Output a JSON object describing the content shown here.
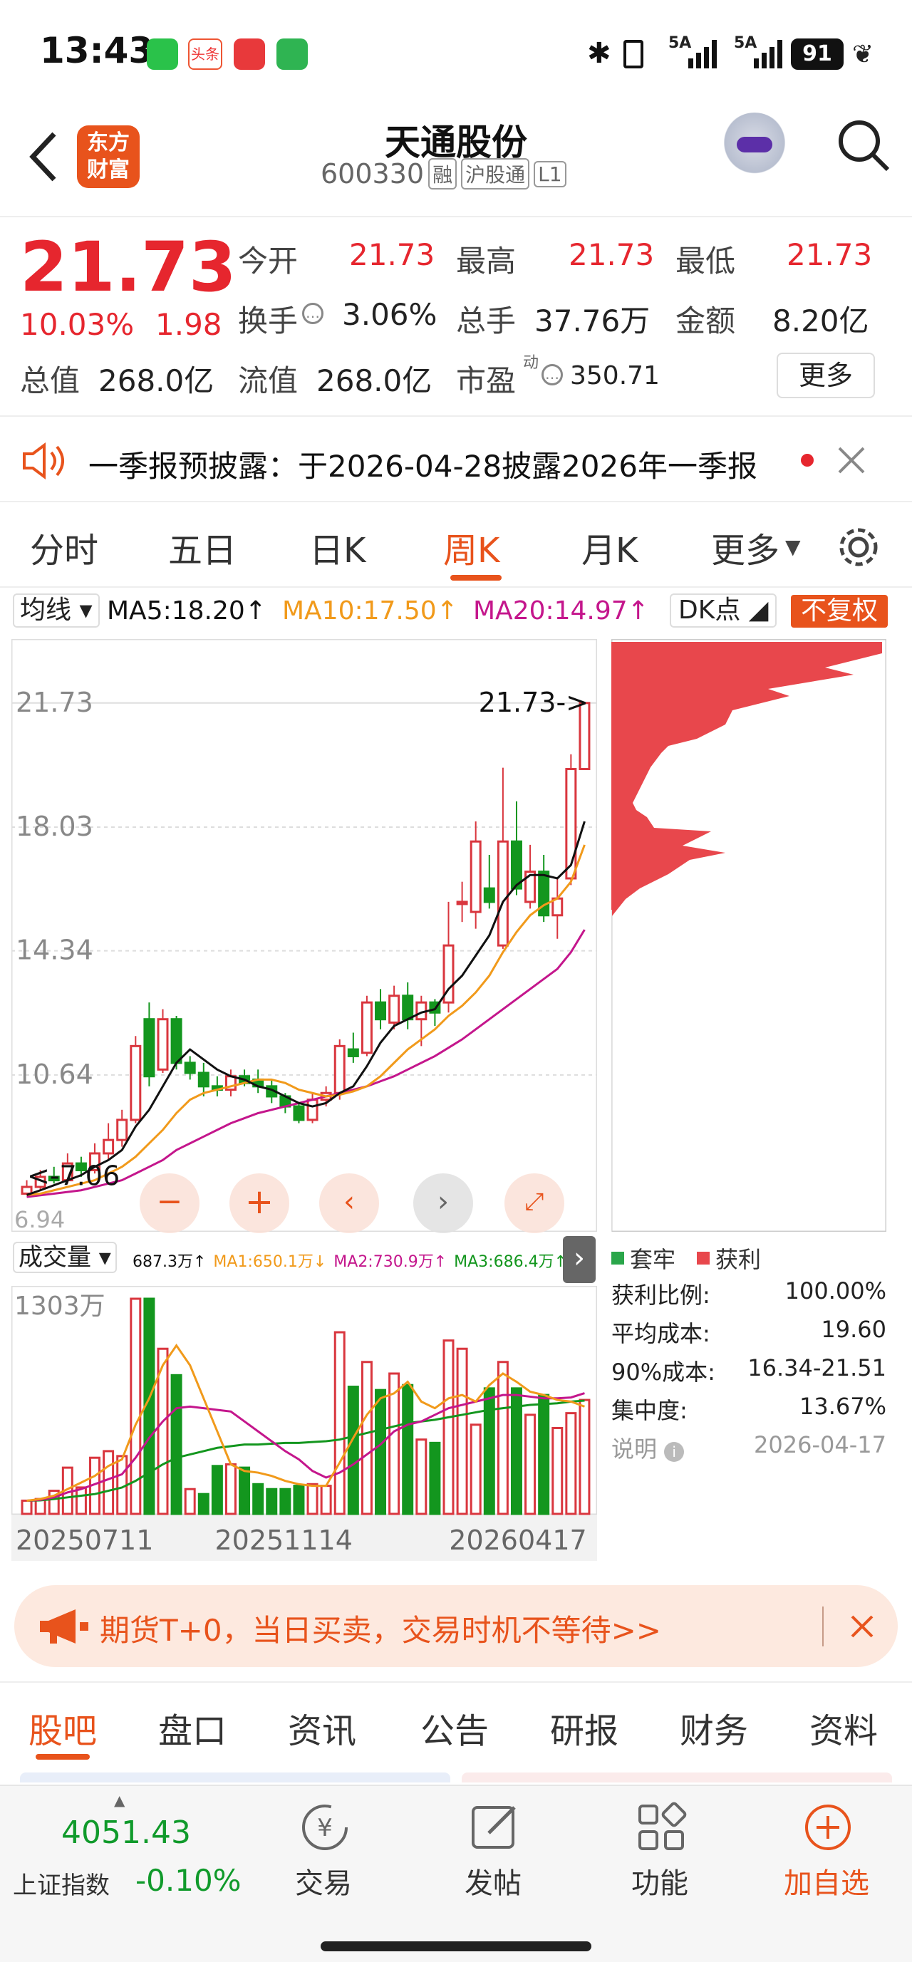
{
  "status_bar": {
    "time": "13:43",
    "battery": "91",
    "network1": "5A",
    "network2": "5A"
  },
  "header": {
    "title": "天通股份",
    "code": "600330",
    "badges": [
      "融",
      "沪股通",
      "L1"
    ],
    "logo_text": [
      "东方",
      "财富"
    ]
  },
  "quote": {
    "price": "21.73",
    "change_pct": "10.03%",
    "change_amt": "1.98",
    "open_label": "今开",
    "open": "21.73",
    "high_label": "最高",
    "high": "21.73",
    "low_label": "最低",
    "low": "21.73",
    "turnover_label": "换手",
    "turnover": "3.06%",
    "volume_label": "总手",
    "volume": "37.76万",
    "amount_label": "金额",
    "amount": "8.20亿",
    "total_value_label": "总值",
    "total_value": "268.0亿",
    "float_value_label": "流值",
    "float_value": "268.0亿",
    "pe_label": "市盈",
    "pe_sup": "动",
    "pe": "350.71",
    "more_button": "更多"
  },
  "notice": {
    "text": "一季报预披露：于2026-04-28披露2026年一季报"
  },
  "tabs": {
    "items": [
      "分时",
      "五日",
      "日K",
      "周K",
      "月K",
      "更多"
    ],
    "active": "周K"
  },
  "indicators": {
    "ma_selector": "均线",
    "ma5": "MA5:18.20↑",
    "ma10": "MA10:17.50↑",
    "ma20": "MA20:14.97↑",
    "dk": "DK点",
    "fq": "不复权",
    "colors": {
      "ma5": "#111111",
      "ma10": "#f19a1b",
      "ma20": "#c4168c"
    }
  },
  "chart_data": {
    "type": "candlestick",
    "price_ticks": [
      "21.73",
      "18.03",
      "14.34",
      "10.64"
    ],
    "high_marker": "21.73->",
    "low_marker": "<-7.06",
    "low_partial": "6.94",
    "volume_title": "成交量",
    "volume_info": [
      "687.3万↑",
      "MA1:650.1万↓",
      "MA2:730.9万↑",
      "MA3:686.4万↑"
    ],
    "volume_max": "1303万",
    "date_labels": [
      "20250711",
      "20251114",
      "20260417"
    ],
    "candles": [
      {
        "o": 7.1,
        "c": 7.3,
        "h": 7.5,
        "l": 7.06,
        "up": true
      },
      {
        "o": 7.3,
        "c": 7.6,
        "h": 7.8,
        "l": 7.2,
        "up": true
      },
      {
        "o": 7.6,
        "c": 7.5,
        "h": 7.9,
        "l": 7.4,
        "up": false
      },
      {
        "o": 7.5,
        "c": 8.0,
        "h": 8.3,
        "l": 7.4,
        "up": true
      },
      {
        "o": 8.0,
        "c": 7.8,
        "h": 8.2,
        "l": 7.6,
        "up": false
      },
      {
        "o": 7.8,
        "c": 8.3,
        "h": 8.6,
        "l": 7.7,
        "up": true
      },
      {
        "o": 8.3,
        "c": 8.7,
        "h": 9.2,
        "l": 8.1,
        "up": true
      },
      {
        "o": 8.7,
        "c": 9.3,
        "h": 9.6,
        "l": 8.5,
        "up": true
      },
      {
        "o": 9.3,
        "c": 11.5,
        "h": 11.8,
        "l": 9.2,
        "up": true
      },
      {
        "o": 12.3,
        "c": 10.6,
        "h": 12.8,
        "l": 10.3,
        "up": false
      },
      {
        "o": 10.8,
        "c": 12.3,
        "h": 12.6,
        "l": 10.7,
        "up": true
      },
      {
        "o": 12.3,
        "c": 11.0,
        "h": 12.4,
        "l": 10.8,
        "up": false
      },
      {
        "o": 11.0,
        "c": 10.7,
        "h": 11.2,
        "l": 10.5,
        "up": false
      },
      {
        "o": 10.7,
        "c": 10.3,
        "h": 11.0,
        "l": 10.0,
        "up": false
      },
      {
        "o": 10.3,
        "c": 10.2,
        "h": 10.6,
        "l": 10.0,
        "up": false
      },
      {
        "o": 10.2,
        "c": 10.6,
        "h": 10.8,
        "l": 10.0,
        "up": true
      },
      {
        "o": 10.6,
        "c": 10.4,
        "h": 10.8,
        "l": 10.3,
        "up": false
      },
      {
        "o": 10.5,
        "c": 10.3,
        "h": 10.8,
        "l": 10.1,
        "up": false
      },
      {
        "o": 10.3,
        "c": 10.0,
        "h": 10.5,
        "l": 9.8,
        "up": false
      },
      {
        "o": 10.0,
        "c": 9.7,
        "h": 10.1,
        "l": 9.5,
        "up": false
      },
      {
        "o": 9.7,
        "c": 9.3,
        "h": 9.8,
        "l": 9.2,
        "up": false
      },
      {
        "o": 9.3,
        "c": 9.9,
        "h": 10.1,
        "l": 9.2,
        "up": true
      },
      {
        "o": 9.9,
        "c": 10.1,
        "h": 10.3,
        "l": 9.7,
        "up": true
      },
      {
        "o": 10.1,
        "c": 11.5,
        "h": 11.7,
        "l": 9.9,
        "up": true
      },
      {
        "o": 11.4,
        "c": 11.2,
        "h": 11.9,
        "l": 11.0,
        "up": false
      },
      {
        "o": 11.3,
        "c": 12.8,
        "h": 13.0,
        "l": 11.2,
        "up": true
      },
      {
        "o": 12.8,
        "c": 12.3,
        "h": 13.2,
        "l": 12.0,
        "up": false
      },
      {
        "o": 12.2,
        "c": 13.0,
        "h": 13.3,
        "l": 12.0,
        "up": true
      },
      {
        "o": 13.0,
        "c": 12.3,
        "h": 13.4,
        "l": 12.0,
        "up": false
      },
      {
        "o": 12.3,
        "c": 12.8,
        "h": 13.0,
        "l": 11.5,
        "up": true
      },
      {
        "o": 12.8,
        "c": 12.5,
        "h": 12.9,
        "l": 12.1,
        "up": false
      },
      {
        "o": 12.8,
        "c": 14.5,
        "h": 15.8,
        "l": 12.5,
        "up": true
      },
      {
        "o": 15.8,
        "c": 15.8,
        "h": 16.4,
        "l": 15.2,
        "up": true
      },
      {
        "o": 15.5,
        "c": 17.6,
        "h": 18.2,
        "l": 15.0,
        "up": true
      },
      {
        "o": 16.2,
        "c": 15.8,
        "h": 17.2,
        "l": 15.6,
        "up": false
      },
      {
        "o": 14.5,
        "c": 17.6,
        "h": 19.8,
        "l": 14.4,
        "up": true
      },
      {
        "o": 17.6,
        "c": 16.2,
        "h": 18.8,
        "l": 16.0,
        "up": false
      },
      {
        "o": 15.8,
        "c": 16.7,
        "h": 17.5,
        "l": 15.6,
        "up": true
      },
      {
        "o": 16.7,
        "c": 15.4,
        "h": 17.2,
        "l": 15.2,
        "up": false
      },
      {
        "o": 15.4,
        "c": 15.9,
        "h": 16.5,
        "l": 14.7,
        "up": true
      },
      {
        "o": 16.5,
        "c": 19.76,
        "h": 20.2,
        "l": 16.3,
        "up": true
      },
      {
        "o": 19.76,
        "c": 21.73,
        "h": 21.73,
        "l": 19.76,
        "up": true
      }
    ],
    "volumes": [
      {
        "v": 80,
        "up": true
      },
      {
        "v": 90,
        "up": true
      },
      {
        "v": 140,
        "up": true
      },
      {
        "v": 280,
        "up": true
      },
      {
        "v": 160,
        "up": true
      },
      {
        "v": 340,
        "up": true
      },
      {
        "v": 380,
        "up": true
      },
      {
        "v": 350,
        "up": true
      },
      {
        "v": 1303,
        "up": true
      },
      {
        "v": 1303,
        "up": false
      },
      {
        "v": 1000,
        "up": true
      },
      {
        "v": 840,
        "up": false
      },
      {
        "v": 150,
        "up": true
      },
      {
        "v": 120,
        "up": false
      },
      {
        "v": 290,
        "up": false
      },
      {
        "v": 300,
        "up": true
      },
      {
        "v": 280,
        "up": false
      },
      {
        "v": 180,
        "up": false
      },
      {
        "v": 150,
        "up": false
      },
      {
        "v": 150,
        "up": false
      },
      {
        "v": 170,
        "up": false
      },
      {
        "v": 180,
        "up": true
      },
      {
        "v": 170,
        "up": true
      },
      {
        "v": 1100,
        "up": true
      },
      {
        "v": 770,
        "up": false
      },
      {
        "v": 920,
        "up": true
      },
      {
        "v": 750,
        "up": false
      },
      {
        "v": 850,
        "up": true
      },
      {
        "v": 780,
        "up": false
      },
      {
        "v": 450,
        "up": true
      },
      {
        "v": 430,
        "up": false
      },
      {
        "v": 1050,
        "up": true
      },
      {
        "v": 1000,
        "up": true
      },
      {
        "v": 540,
        "up": true
      },
      {
        "v": 760,
        "up": false
      },
      {
        "v": 920,
        "up": true
      },
      {
        "v": 760,
        "up": false
      },
      {
        "v": 600,
        "up": true
      },
      {
        "v": 720,
        "up": false
      },
      {
        "v": 520,
        "up": true
      },
      {
        "v": 610,
        "up": true
      },
      {
        "v": 690,
        "up": true
      }
    ],
    "ma5_line": [
      7.06,
      7.2,
      7.35,
      7.5,
      7.65,
      7.9,
      8.1,
      8.4,
      9.1,
      9.6,
      10.3,
      11.0,
      11.4,
      11.1,
      10.8,
      10.6,
      10.5,
      10.3,
      10.2,
      10.0,
      9.8,
      9.7,
      9.8,
      10.1,
      10.3,
      10.9,
      11.6,
      12.1,
      12.3,
      12.5,
      12.6,
      13.2,
      13.6,
      14.2,
      14.8,
      15.8,
      16.3,
      16.6,
      16.6,
      16.5,
      16.9,
      18.2
    ],
    "ma10_line": [
      7.06,
      7.1,
      7.2,
      7.3,
      7.4,
      7.5,
      7.7,
      7.9,
      8.2,
      8.6,
      9.0,
      9.5,
      9.9,
      10.1,
      10.2,
      10.3,
      10.4,
      10.5,
      10.5,
      10.4,
      10.2,
      10.1,
      10.0,
      10.05,
      10.15,
      10.3,
      10.6,
      11.0,
      11.4,
      11.7,
      12.0,
      12.4,
      12.7,
      13.1,
      13.6,
      14.3,
      14.9,
      15.4,
      15.7,
      15.9,
      16.4,
      17.5
    ],
    "ma20_line": [
      7.0,
      7.05,
      7.1,
      7.15,
      7.2,
      7.3,
      7.4,
      7.5,
      7.7,
      7.9,
      8.1,
      8.4,
      8.6,
      8.8,
      9.0,
      9.2,
      9.35,
      9.5,
      9.6,
      9.7,
      9.8,
      9.9,
      10.0,
      10.1,
      10.2,
      10.3,
      10.45,
      10.6,
      10.8,
      11.0,
      11.2,
      11.45,
      11.7,
      12.0,
      12.3,
      12.6,
      12.9,
      13.2,
      13.5,
      13.8,
      14.3,
      14.97
    ],
    "vol_ma1": [
      80,
      90,
      110,
      150,
      190,
      230,
      290,
      330,
      540,
      700,
      900,
      1020,
      900,
      700,
      500,
      300,
      260,
      250,
      230,
      200,
      180,
      170,
      170,
      310,
      460,
      600,
      700,
      730,
      800,
      680,
      640,
      700,
      720,
      680,
      780,
      850,
      800,
      740,
      720,
      690,
      680,
      650
    ],
    "vol_ma2": [
      80,
      85,
      100,
      130,
      150,
      180,
      210,
      240,
      340,
      460,
      560,
      640,
      650,
      640,
      630,
      620,
      560,
      500,
      440,
      380,
      330,
      260,
      220,
      250,
      300,
      360,
      420,
      500,
      540,
      560,
      600,
      640,
      660,
      680,
      700,
      720,
      720,
      710,
      700,
      700,
      705,
      731
    ],
    "vol_ma3": [
      80,
      82,
      90,
      100,
      110,
      120,
      140,
      160,
      200,
      250,
      300,
      340,
      360,
      380,
      400,
      410,
      420,
      420,
      425,
      430,
      430,
      435,
      440,
      450,
      470,
      490,
      510,
      530,
      550,
      560,
      570,
      585,
      600,
      615,
      630,
      640,
      650,
      660,
      665,
      670,
      680,
      686
    ]
  },
  "chip": {
    "legend_trap": "套牢",
    "legend_profit": "获利",
    "rows": [
      {
        "label": "获利比例:",
        "value": "100.00%"
      },
      {
        "label": "平均成本:",
        "value": "19.60"
      },
      {
        "label": "90%成本:",
        "value": "16.34-21.51"
      },
      {
        "label": "集中度:",
        "value": "13.67%"
      }
    ],
    "note_label": "说明",
    "note_date": "2026-04-17"
  },
  "promo": {
    "text": "期货T+0，当日买卖，交易时机不等待>>"
  },
  "bottom_tabs": {
    "items": [
      "股吧",
      "盘口",
      "资讯",
      "公告",
      "研报",
      "财务",
      "资料"
    ],
    "active": "股吧"
  },
  "bottom_bar": {
    "index_value": "4051.43",
    "index_name": "上证指数",
    "index_change": "-0.10%",
    "actions": [
      "交易",
      "发帖",
      "功能",
      "加自选"
    ]
  }
}
